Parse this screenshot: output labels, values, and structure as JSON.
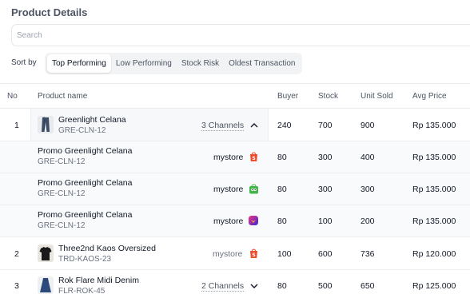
{
  "header": {
    "title": "Product Details"
  },
  "search": {
    "placeholder": "Search"
  },
  "sort": {
    "label": "Sort by",
    "options": [
      "Top Performing",
      "Low Performing",
      "Stock Risk",
      "Oldest Transaction"
    ],
    "active": "Top Performing"
  },
  "table": {
    "columns": {
      "no": "No",
      "product": "Product name",
      "buyer": "Buyer",
      "stock": "Stock",
      "unit_sold": "Unit Sold",
      "avg_price": "Avg Price"
    },
    "rows": [
      {
        "no": "1",
        "name": "Greenlight Celana",
        "sku": "GRE-CLN-12",
        "channels": "3 Channels",
        "buyer": "240",
        "stock": "700",
        "unit_sold": "900",
        "avg_price": "Rp 135.000",
        "thumb_icon": "jeans-icon",
        "expanded": true
      },
      {
        "name": "Promo Greenlight Celana",
        "sku": "GRE-CLN-12",
        "store": "mystore",
        "store_icon": "shopee-icon",
        "buyer": "80",
        "stock": "300",
        "unit_sold": "400",
        "avg_price": "Rp 135.000"
      },
      {
        "name": "Promo Greenlight Celana",
        "sku": "GRE-CLN-12",
        "store": "mystore",
        "store_icon": "tokopedia-icon",
        "buyer": "80",
        "stock": "300",
        "unit_sold": "300",
        "avg_price": "Rp 135.000"
      },
      {
        "name": "Promo Greenlight Celana",
        "sku": "GRE-CLN-12",
        "store": "mystore",
        "store_icon": "lazada-icon",
        "buyer": "80",
        "stock": "100",
        "unit_sold": "200",
        "avg_price": "Rp 135.000"
      },
      {
        "no": "2",
        "name": "Three2nd Kaos Oversized",
        "sku": "TRD-KAOS-23",
        "store": "mystore",
        "store_icon": "shopee-icon",
        "buyer": "100",
        "stock": "600",
        "unit_sold": "736",
        "avg_price": "Rp 120.000",
        "thumb_icon": "tshirt-icon"
      },
      {
        "no": "3",
        "name": "Rok Flare Midi Denim",
        "sku": "FLR-ROK-45",
        "channels": "2 Channels",
        "buyer": "80",
        "stock": "500",
        "unit_sold": "650",
        "avg_price": "Rp 125.000",
        "thumb_icon": "skirt-icon",
        "expanded": false
      }
    ]
  },
  "colors": {
    "shopee": "#ee4d2d",
    "tokopedia": "#42b549",
    "lazada": "#3b2ad6",
    "accent_border": "#e5e7eb"
  }
}
